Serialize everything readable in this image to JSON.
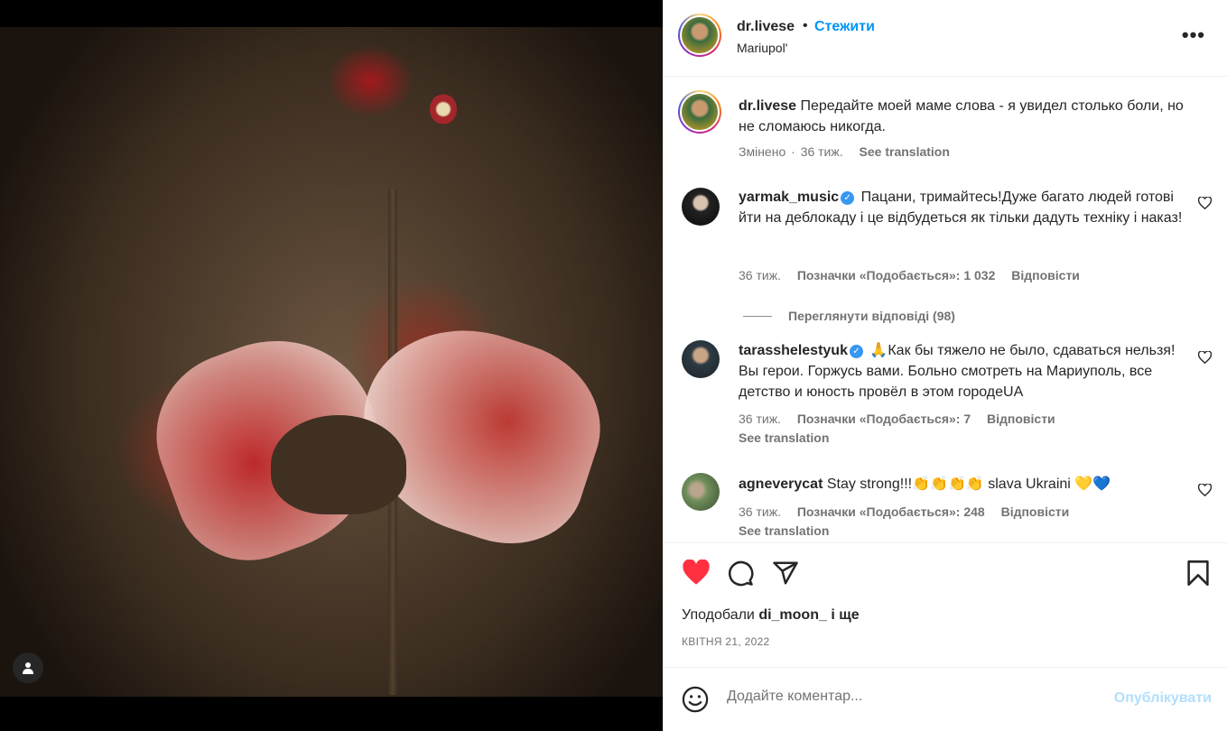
{
  "post": {
    "username": "dr.livese",
    "separator": "•",
    "follow_label": "Стежити",
    "location": "Mariupol'",
    "more_label": "•••"
  },
  "caption": {
    "username": "dr.livese",
    "text": "Передайте моей маме слова - я увидел столько боли, но не сломаюсь никогда.",
    "edited": "Змінено",
    "dot": "·",
    "time": "36 тиж.",
    "see_translation": "See translation"
  },
  "comments": [
    {
      "username": "yarmak_music",
      "verified": true,
      "text": "Пацани, тримайтесь!Дуже багато людей готові йти на деблокаду і це відбудеться як тільки дадуть техніку і наказ!",
      "time": "36 тиж.",
      "likes": "Позначки «Подобається»: 1 032",
      "reply": "Відповісти",
      "view_replies": "Переглянути відповіді (98)"
    },
    {
      "username": "tarasshelestyuk",
      "verified": true,
      "text": "🙏Как бы тяжело не было, сдаваться нельзя! Вы герои. Горжусь вами. Больно смотреть на Мариуполь, все детство и юность провёл в этом городеUA",
      "time": "36 тиж.",
      "likes": "Позначки «Подобається»: 7",
      "reply": "Відповісти",
      "see_translation": "See translation"
    },
    {
      "username": "agneverycat",
      "verified": false,
      "text": "Stay strong!!!👏👏👏👏 slava Ukraini 💛💙",
      "time": "36 тиж.",
      "likes": "Позначки «Подобається»: 248",
      "reply": "Відповісти",
      "see_translation": "See translation"
    }
  ],
  "actions": {
    "liked_by_prefix": "Уподобали",
    "liked_by_user": "di_moon_",
    "liked_by_suffix": "і ще",
    "date": "КВІТНЯ 21, 2022"
  },
  "add_comment": {
    "placeholder": "Додайте коментар...",
    "post_label": "Опублікувати"
  },
  "colors": {
    "accent": "#0095f6",
    "like_red": "#ff3040",
    "post_disabled": "#b2dffc",
    "verified": "#3897f0"
  }
}
